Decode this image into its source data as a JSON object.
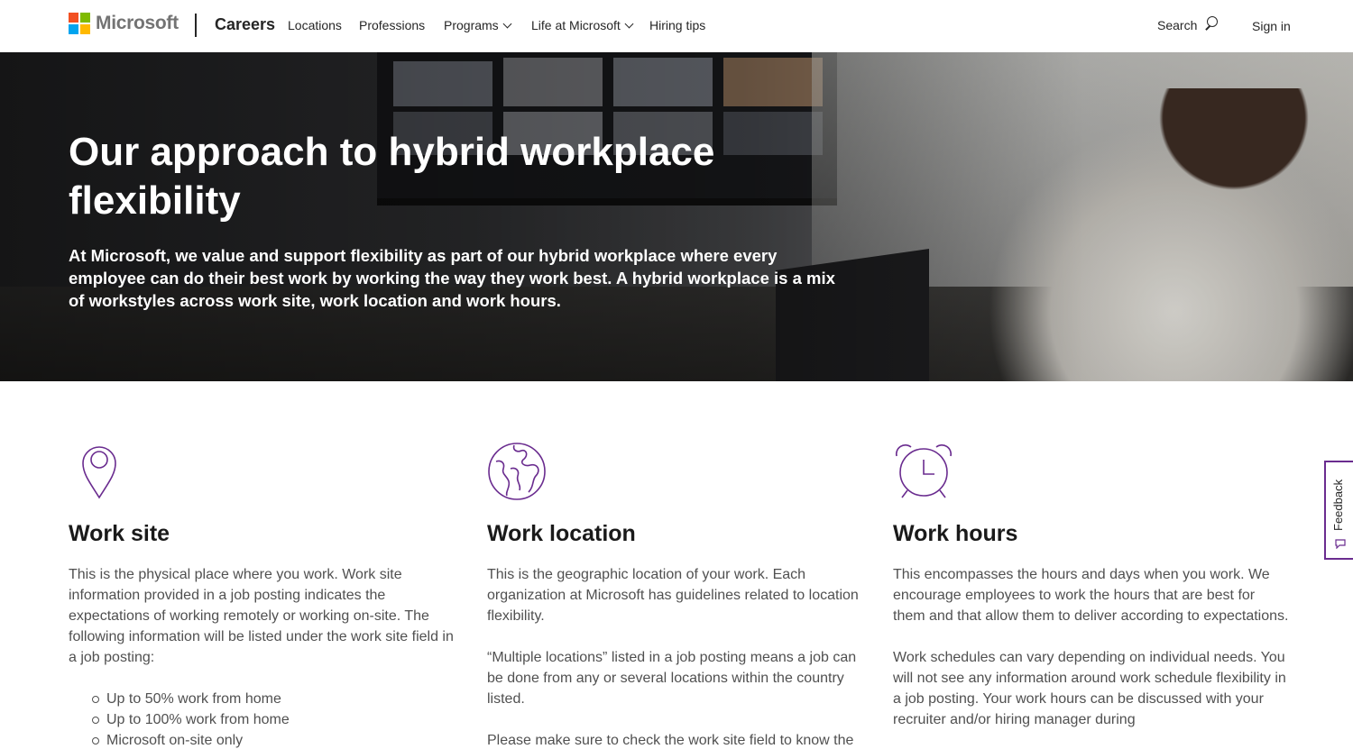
{
  "header": {
    "brand": "Microsoft",
    "brand_colors": [
      "#f25022",
      "#7fba00",
      "#00a4ef",
      "#ffb900"
    ],
    "section": "Careers",
    "nav": [
      {
        "label": "Locations",
        "has_dropdown": false
      },
      {
        "label": "Professions",
        "has_dropdown": false
      },
      {
        "label": "Programs",
        "has_dropdown": true
      },
      {
        "label": "Life at Microsoft",
        "has_dropdown": true
      },
      {
        "label": "Hiring tips",
        "has_dropdown": false
      }
    ],
    "search_label": "Search",
    "signin_label": "Sign in"
  },
  "hero": {
    "title": "Our approach to hybrid workplace flexibility",
    "subtitle": "At Microsoft, we value and support flexibility as part of our hybrid workplace where every employee can do their best work by working the way they work best. A hybrid workplace is a mix of workstyles across work site, work location and work hours."
  },
  "columns": [
    {
      "icon": "location-pin-icon",
      "title": "Work site",
      "paragraphs": [
        "This is the physical place where you work. Work site information provided in a job posting indicates the expectations of working remotely or working on-site. The following information will be listed under the work site field in a job posting:"
      ],
      "list": [
        "Up to 50% work from home",
        "Up to 100% work from home",
        "Microsoft on-site only"
      ]
    },
    {
      "icon": "globe-icon",
      "title": "Work location",
      "paragraphs": [
        "This is the geographic location of your work. Each organization at Microsoft has guidelines related to location flexibility.",
        "“Multiple locations” listed in a job posting means a job can be done from any or several locations within the country listed.",
        "Please make sure to check the work site field to know the"
      ]
    },
    {
      "icon": "alarm-clock-icon",
      "title": "Work hours",
      "paragraphs": [
        "This encompasses the hours and days when you work. We encourage employees to work the hours that are best for them and that allow them to deliver according to expectations.",
        "Work schedules can vary depending on individual needs. You will not see any information around work schedule flexibility in a job posting. Your work hours can be discussed with your recruiter and/or hiring manager during"
      ]
    }
  ],
  "feedback": {
    "label": "Feedback"
  },
  "accent_color": "#6a2c8f"
}
